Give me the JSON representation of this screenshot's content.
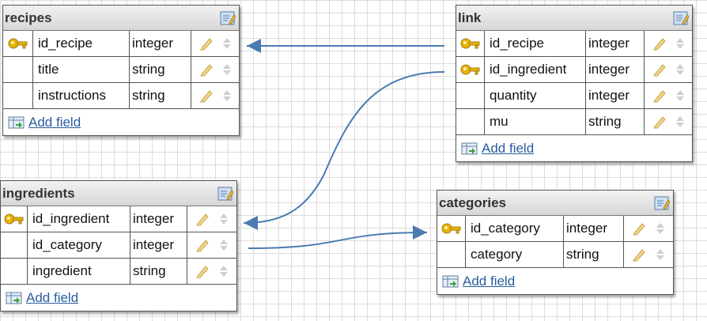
{
  "tables": {
    "recipes": {
      "title": "recipes",
      "add_field": "Add field",
      "fields": [
        {
          "name": "id_recipe",
          "type": "integer",
          "key": true
        },
        {
          "name": "title",
          "type": "string",
          "key": false
        },
        {
          "name": "instructions",
          "type": "string",
          "key": false
        }
      ]
    },
    "link": {
      "title": "link",
      "add_field": "Add field",
      "fields": [
        {
          "name": "id_recipe",
          "type": "integer",
          "key": true
        },
        {
          "name": "id_ingredient",
          "type": "integer",
          "key": true
        },
        {
          "name": "quantity",
          "type": "integer",
          "key": false
        },
        {
          "name": "mu",
          "type": "string",
          "key": false
        }
      ]
    },
    "ingredients": {
      "title": "ingredients",
      "add_field": "Add field",
      "fields": [
        {
          "name": "id_ingredient",
          "type": "integer",
          "key": true
        },
        {
          "name": "id_category",
          "type": "integer",
          "key": false
        },
        {
          "name": "ingredient",
          "type": "string",
          "key": false
        }
      ]
    },
    "categories": {
      "title": "categories",
      "add_field": "Add field",
      "fields": [
        {
          "name": "id_category",
          "type": "integer",
          "key": true
        },
        {
          "name": "category",
          "type": "string",
          "key": false
        }
      ]
    }
  },
  "colors": {
    "connector": "#4a7bb0",
    "link_text": "#2a5d9f",
    "header_top": "#f2f2f2",
    "header_bottom": "#d6d6d6",
    "key": "#e8b300"
  }
}
